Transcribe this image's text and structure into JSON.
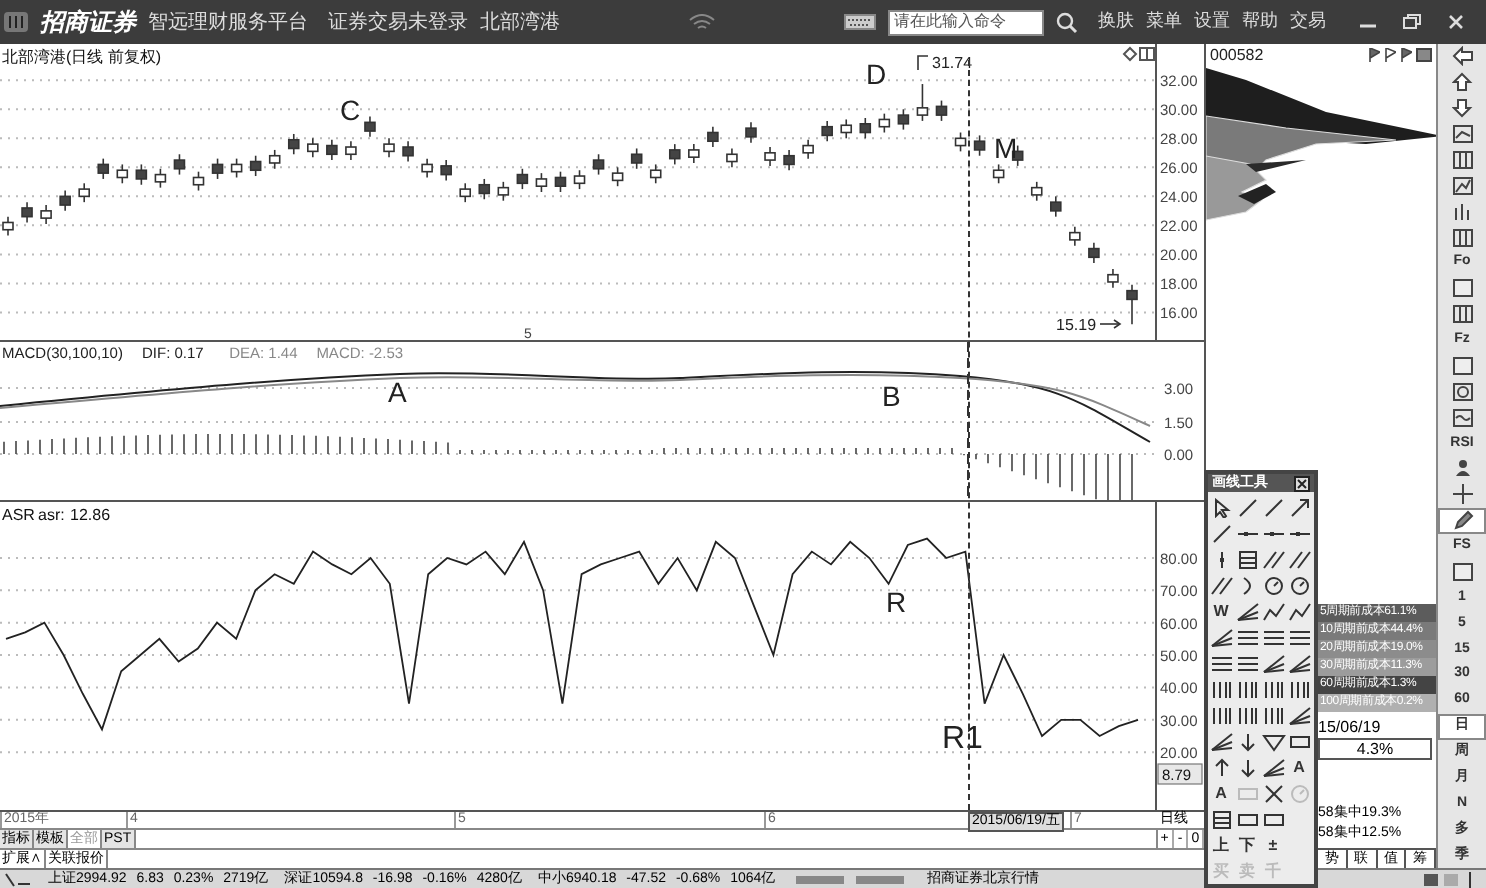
{
  "title_bar": {
    "logo": "招商证券",
    "slogan": "智远理财服务平台",
    "login_status": "证券交易未登录",
    "stock": "北部湾港",
    "search": {
      "placeholder": "请在此输入命令"
    },
    "menu": [
      "换肤",
      "菜单",
      "设置",
      "帮助",
      "交易"
    ]
  },
  "price_chart": {
    "title": "北部湾港(日线 前复权)",
    "high": "31.74",
    "low": "15.19",
    "marks": [
      "C",
      "D",
      "M"
    ],
    "tick": "5",
    "chart_data": {
      "type": "candlestick",
      "grid": true,
      "ylim": [
        14.1,
        34.5
      ],
      "yticks": [
        {
          "value": 32,
          "label": "32.00"
        },
        {
          "value": 30,
          "label": "30.00"
        },
        {
          "value": 28,
          "label": "28.00"
        },
        {
          "value": 26,
          "label": "26.00"
        },
        {
          "value": 24,
          "label": "24.00"
        },
        {
          "value": 22,
          "label": "22.00"
        },
        {
          "value": 20,
          "label": "20.00"
        },
        {
          "value": 18,
          "label": "18.00"
        },
        {
          "value": 16,
          "label": "16.00"
        }
      ],
      "ohlc": [
        [
          21.7,
          22.6,
          21.3,
          22.2
        ],
        [
          23.2,
          23.6,
          22.2,
          22.6
        ],
        [
          22.5,
          23.4,
          22.1,
          23.0
        ],
        [
          24.0,
          24.4,
          23.0,
          23.4
        ],
        [
          24.0,
          24.9,
          23.6,
          24.5
        ],
        [
          26.2,
          26.6,
          25.2,
          25.6
        ],
        [
          25.3,
          26.2,
          24.9,
          25.8
        ],
        [
          25.8,
          26.2,
          24.8,
          25.2
        ],
        [
          25.0,
          25.9,
          24.6,
          25.5
        ],
        [
          26.5,
          26.9,
          25.5,
          25.9
        ],
        [
          24.8,
          25.7,
          24.4,
          25.3
        ],
        [
          26.2,
          26.6,
          25.2,
          25.6
        ],
        [
          25.7,
          26.6,
          25.3,
          26.2
        ],
        [
          26.4,
          26.8,
          25.4,
          25.8
        ],
        [
          26.3,
          27.2,
          25.9,
          26.8
        ],
        [
          27.9,
          28.3,
          26.9,
          27.3
        ],
        [
          27.1,
          28.0,
          26.7,
          27.6
        ],
        [
          27.5,
          27.9,
          26.5,
          26.9
        ],
        [
          26.9,
          27.8,
          26.5,
          27.4
        ],
        [
          29.1,
          29.5,
          28.1,
          28.5
        ],
        [
          27.1,
          28.0,
          26.7,
          27.6
        ],
        [
          27.4,
          27.8,
          26.4,
          26.8
        ],
        [
          25.7,
          26.6,
          25.3,
          26.2
        ],
        [
          26.1,
          26.5,
          25.1,
          25.5
        ],
        [
          24.0,
          24.9,
          23.6,
          24.5
        ],
        [
          24.8,
          25.2,
          23.8,
          24.2
        ],
        [
          24.1,
          25.0,
          23.7,
          24.6
        ],
        [
          25.5,
          25.9,
          24.5,
          24.9
        ],
        [
          24.7,
          25.6,
          24.3,
          25.2
        ],
        [
          25.3,
          25.7,
          24.3,
          24.7
        ],
        [
          24.9,
          25.8,
          24.5,
          25.4
        ],
        [
          26.5,
          26.9,
          25.5,
          25.9
        ],
        [
          25.1,
          26.0,
          24.7,
          25.6
        ],
        [
          26.9,
          27.3,
          25.9,
          26.3
        ],
        [
          25.3,
          26.2,
          24.9,
          25.8
        ],
        [
          27.2,
          27.6,
          26.2,
          26.6
        ],
        [
          26.7,
          27.6,
          26.3,
          27.2
        ],
        [
          28.4,
          28.8,
          27.4,
          27.8
        ],
        [
          26.4,
          27.3,
          26.0,
          26.9
        ],
        [
          28.7,
          29.1,
          27.7,
          28.1
        ],
        [
          26.5,
          27.4,
          26.1,
          27.0
        ],
        [
          26.8,
          27.2,
          25.8,
          26.2
        ],
        [
          27.0,
          27.9,
          26.6,
          27.5
        ],
        [
          28.8,
          29.2,
          27.8,
          28.2
        ],
        [
          28.4,
          29.3,
          28.0,
          28.9
        ],
        [
          29.0,
          29.4,
          28.0,
          28.4
        ],
        [
          28.8,
          29.7,
          28.4,
          29.3
        ],
        [
          29.6,
          30.0,
          28.6,
          29.0
        ],
        [
          29.6,
          31.74,
          29.2,
          30.1
        ],
        [
          30.2,
          30.6,
          29.2,
          29.6
        ],
        [
          27.5,
          28.4,
          27.1,
          28.0
        ],
        [
          27.8,
          28.2,
          26.8,
          27.2
        ],
        [
          25.3,
          26.2,
          24.9,
          25.8
        ],
        [
          27.1,
          27.5,
          26.1,
          26.5
        ],
        [
          24.1,
          25.0,
          23.7,
          24.6
        ],
        [
          23.6,
          24.0,
          22.6,
          23.0
        ],
        [
          21.0,
          21.9,
          20.6,
          21.5
        ],
        [
          20.4,
          20.8,
          19.4,
          19.8
        ],
        [
          18.1,
          19.0,
          17.7,
          18.6
        ],
        [
          17.5,
          17.9,
          15.19,
          16.9
        ]
      ]
    }
  },
  "macd_chart": {
    "legend": [
      {
        "text": "MACD(30,100,10)",
        "color": "#222222"
      },
      {
        "text": "DIF: 0.17",
        "color": "#222222"
      },
      {
        "text": "DEA: 1.44",
        "color": "#888888"
      },
      {
        "text": "MACD: -2.53",
        "color": "#888888"
      }
    ],
    "yaxis": [
      "3.00",
      "1.50",
      "0.00"
    ],
    "marks": [
      "A",
      "B"
    ]
  },
  "asr_chart": {
    "title": "ASR",
    "reading": "12.86",
    "marks": [
      "R",
      "R1"
    ],
    "last_value": "8.79",
    "chart_data": {
      "type": "line",
      "grid": true,
      "ylim": [
        1.5,
        97.3
      ],
      "yticks": [
        {
          "value": 80,
          "label": "80.00"
        },
        {
          "value": 70,
          "label": "70.00"
        },
        {
          "value": 60,
          "label": "60.00"
        },
        {
          "value": 50,
          "label": "50.00"
        },
        {
          "value": 40,
          "label": "40.00"
        },
        {
          "value": 30,
          "label": "30.00"
        },
        {
          "value": 20,
          "label": "20.00"
        }
      ],
      "series": [
        {
          "name": "asr:",
          "color": "#222222",
          "values": [
            55,
            57,
            60,
            50,
            38,
            27,
            45,
            50,
            55,
            48,
            52,
            60,
            55,
            70,
            75,
            72,
            82,
            78,
            75,
            80,
            72,
            35,
            75,
            80,
            78,
            82,
            75,
            85,
            70,
            35,
            75,
            78,
            80,
            82,
            72,
            80,
            70,
            85,
            80,
            65,
            50,
            75,
            82,
            78,
            85,
            80,
            72,
            84,
            86,
            80,
            82,
            35,
            50,
            38,
            25,
            30,
            30,
            25,
            28,
            30
          ]
        }
      ]
    }
  },
  "date_axis": [
    {
      "text": "2015年",
      "selected": false
    },
    {
      "text": "4",
      "selected": false
    },
    {
      "text": "5",
      "selected": false
    },
    {
      "text": "6",
      "selected": false
    },
    {
      "text": "2015/06/19/五",
      "selected": true
    },
    {
      "text": "7",
      "selected": false
    }
  ],
  "period_label": "日线",
  "zoom_buttons": [
    "+",
    "-",
    "0"
  ],
  "panel_tabs": [
    {
      "label": "指标",
      "disabled": false
    },
    {
      "label": "模板",
      "disabled": false
    },
    {
      "label": "全部",
      "disabled": true
    },
    {
      "label": "PST",
      "disabled": false
    }
  ],
  "extra_tabs": [
    "扩展∧",
    "关联报价"
  ],
  "status_bar": {
    "indices": [
      "上证2994.92 6.83 0.23% 2719亿",
      "深证10594.8 -16.98 -0.16% 4280亿",
      "中小6940.18 -47.52 -0.68% 1064亿"
    ],
    "broker": "招商证券北京行情"
  },
  "chip_panel": {
    "code": "000582",
    "costs": [
      {
        "text": "5周期前成本61.1%",
        "color": "#5c5c5c"
      },
      {
        "text": "10周期前成本44.4%",
        "color": "#7a7a7a"
      },
      {
        "text": "20周期前成本19.0%",
        "color": "#8c8c8c"
      },
      {
        "text": "30周期前成本11.3%",
        "color": "#9c9c9c"
      },
      {
        "text": "60周期前成本1.3%",
        "color": "#444444"
      },
      {
        "text": "100周期前成本0.2%",
        "color": "#b0b0b0"
      }
    ],
    "date": "15/06/19",
    "ratio": "4.3%",
    "concentration": [
      "58集中19.3%",
      "58集中12.5%"
    ],
    "buttons": [
      "势",
      "联",
      "值",
      "筹"
    ]
  },
  "drawing_tools": {
    "title": "画线工具",
    "rows": [
      [
        {
          "kind": "cursor",
          "disabled": false
        },
        {
          "kind": "line",
          "disabled": false
        },
        {
          "kind": "line",
          "disabled": false
        },
        {
          "kind": "arrow",
          "disabled": false
        }
      ],
      [
        {
          "kind": "line",
          "disabled": false
        },
        {
          "kind": "segment",
          "disabled": false
        },
        {
          "kind": "segment",
          "disabled": false
        },
        {
          "kind": "segment",
          "disabled": false
        }
      ],
      [
        {
          "kind": "vline",
          "disabled": false
        },
        {
          "kind": "grid",
          "disabled": false
        },
        {
          "kind": "parallel",
          "disabled": false
        },
        {
          "kind": "parallel",
          "disabled": false
        }
      ],
      [
        {
          "kind": "parallel",
          "disabled": false
        },
        {
          "kind": "arc",
          "disabled": false
        },
        {
          "kind": "circle",
          "disabled": false
        },
        {
          "kind": "circle",
          "disabled": false
        }
      ],
      [
        {
          "kind": "glyph",
          "text": "W",
          "disabled": false
        },
        {
          "kind": "fan",
          "disabled": false
        },
        {
          "kind": "zigzag",
          "disabled": false
        },
        {
          "kind": "zigzag",
          "disabled": false
        }
      ],
      [
        {
          "kind": "fan",
          "disabled": false
        },
        {
          "kind": "channel",
          "disabled": false
        },
        {
          "kind": "channel",
          "disabled": false
        },
        {
          "kind": "channel",
          "disabled": false
        }
      ],
      [
        {
          "kind": "channel",
          "disabled": false
        },
        {
          "kind": "channel",
          "disabled": false
        },
        {
          "kind": "fan",
          "disabled": false
        },
        {
          "kind": "fan",
          "disabled": false
        }
      ],
      [
        {
          "kind": "bars",
          "disabled": false
        },
        {
          "kind": "bars",
          "disabled": false
        },
        {
          "kind": "bars",
          "disabled": false
        },
        {
          "kind": "bars",
          "disabled": false
        }
      ],
      [
        {
          "kind": "bars",
          "disabled": false
        },
        {
          "kind": "bars",
          "disabled": false
        },
        {
          "kind": "bars",
          "disabled": false
        },
        {
          "kind": "fan",
          "disabled": false
        }
      ],
      [
        {
          "kind": "fan",
          "disabled": false
        },
        {
          "kind": "down",
          "disabled": false
        },
        {
          "kind": "triangle",
          "disabled": false
        },
        {
          "kind": "rect",
          "disabled": false
        }
      ],
      [
        {
          "kind": "up",
          "disabled": false
        },
        {
          "kind": "down",
          "disabled": false
        },
        {
          "kind": "fan",
          "disabled": false
        },
        {
          "kind": "glyph",
          "text": "A",
          "disabled": false
        }
      ],
      [
        {
          "kind": "glyph",
          "text": "A",
          "disabled": false
        },
        {
          "kind": "rect",
          "disabled": true
        },
        {
          "kind": "cross",
          "disabled": false
        },
        {
          "kind": "circle",
          "disabled": true
        }
      ],
      [
        {
          "kind": "grid",
          "disabled": false
        },
        {
          "kind": "rect",
          "disabled": false
        },
        {
          "kind": "rect",
          "disabled": false
        }
      ],
      [
        {
          "kind": "glyph",
          "text": "上",
          "disabled": false
        },
        {
          "kind": "glyph",
          "text": "下",
          "disabled": false
        },
        {
          "kind": "glyph",
          "text": "±",
          "disabled": false
        }
      ],
      [
        {
          "kind": "glyph",
          "text": "买",
          "disabled": true
        },
        {
          "kind": "glyph",
          "text": "卖",
          "disabled": true
        },
        {
          "kind": "glyph",
          "text": "千",
          "disabled": true
        }
      ]
    ]
  },
  "right_toolbar": [
    {
      "kind": "left",
      "selected": false
    },
    {
      "kind": "up",
      "selected": false
    },
    {
      "kind": "down",
      "selected": false
    },
    {
      "kind": "chart",
      "selected": false
    },
    {
      "kind": "table",
      "selected": false
    },
    {
      "kind": "line",
      "selected": false
    },
    {
      "kind": "bars",
      "selected": false
    },
    {
      "kind": "table",
      "selected": false
    },
    {
      "kind": "text",
      "text": "Fo",
      "selected": false
    },
    {
      "kind": "box",
      "selected": false
    },
    {
      "kind": "table",
      "selected": false
    },
    {
      "kind": "text",
      "text": "Fz",
      "selected": false
    },
    {
      "kind": "box",
      "selected": false
    },
    {
      "kind": "circle",
      "selected": false
    },
    {
      "kind": "wave",
      "selected": false
    },
    {
      "kind": "text",
      "text": "RSI",
      "selected": false
    },
    {
      "kind": "person",
      "selected": false
    },
    {
      "kind": "move",
      "selected": false
    },
    {
      "kind": "pencil",
      "selected": true
    },
    {
      "kind": "text",
      "text": "FS",
      "selected": false
    },
    {
      "kind": "box",
      "selected": false
    },
    {
      "kind": "text",
      "text": "1",
      "selected": false
    },
    {
      "kind": "text",
      "text": "5",
      "selected": false
    },
    {
      "kind": "text",
      "text": "15",
      "selected": false
    },
    {
      "kind": "text",
      "text": "30",
      "selected": false
    },
    {
      "kind": "text",
      "text": "60",
      "selected": false
    },
    {
      "kind": "text",
      "text": "日",
      "selected": true
    },
    {
      "kind": "text",
      "text": "周",
      "selected": false
    },
    {
      "kind": "text",
      "text": "月",
      "selected": false
    },
    {
      "kind": "text",
      "text": "N",
      "selected": false
    },
    {
      "kind": "text",
      "text": "多",
      "selected": false
    },
    {
      "kind": "text",
      "text": "季",
      "selected": false
    }
  ]
}
